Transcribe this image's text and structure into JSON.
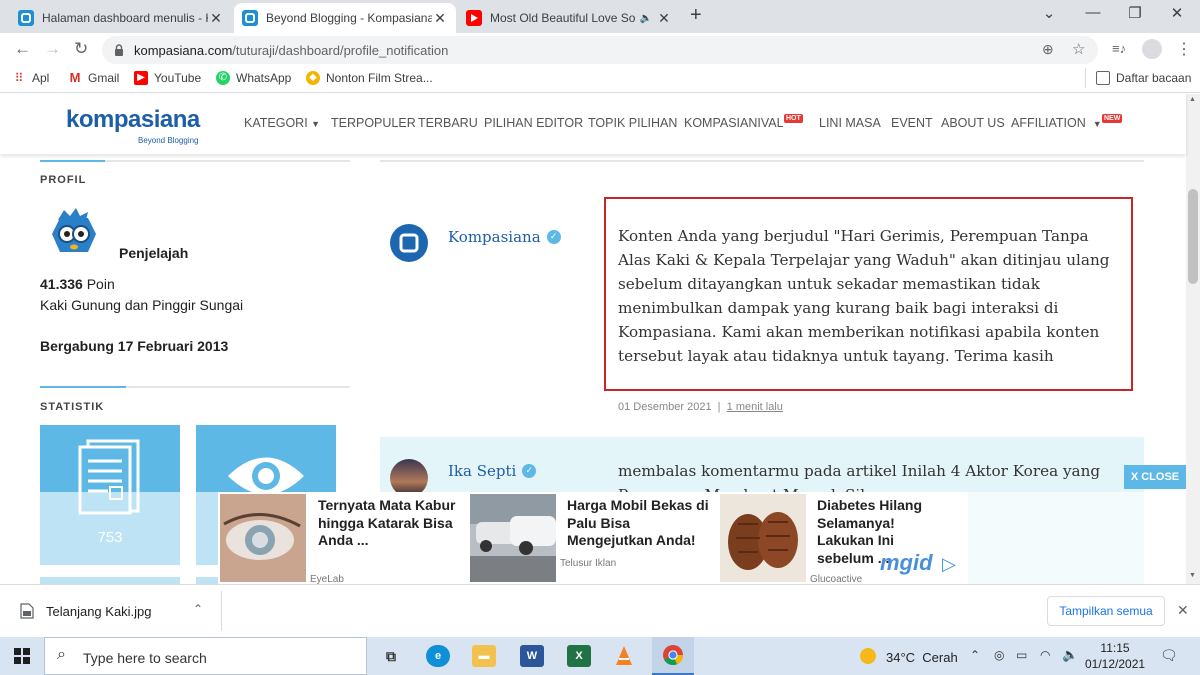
{
  "browser": {
    "tabs": [
      {
        "title": "Halaman dashboard menulis - Ko",
        "active": false
      },
      {
        "title": "Beyond Blogging - Kompasiana.c",
        "active": true
      },
      {
        "title": "Most Old Beautiful Love Son",
        "active": false
      }
    ],
    "url_domain": "kompasiana.com",
    "url_path": "/tuturaji/dashboard/profile_notification",
    "bookmarks": [
      "Apl",
      "Gmail",
      "YouTube",
      "WhatsApp",
      "Nonton Film Strea..."
    ],
    "reading_list": "Daftar bacaan"
  },
  "site": {
    "logo": "kompasiana",
    "tagline": "Beyond Blogging",
    "nav": [
      "KATEGORI",
      "TERPOPULER",
      "TERBARU",
      "PILIHAN EDITOR",
      "TOPIK PILIHAN",
      "KOMPASIANIVAL",
      "LINI MASA",
      "EVENT",
      "ABOUT US",
      "AFFILIATION"
    ],
    "badge_hot": "HOT",
    "badge_new": "NEW"
  },
  "profile": {
    "section_label": "PROFIL",
    "rank": "Penjelajah",
    "points_value": "41.336",
    "points_label": "Poin",
    "bio": "Kaki Gunung dan Pinggir Sungai",
    "joined": "Bergabung 17 Februari 2013"
  },
  "stats": {
    "section_label": "STATISTIK",
    "articles_count": "753"
  },
  "notifications": [
    {
      "sender": "Kompasiana",
      "verified": true,
      "message": "Konten Anda yang berjudul \"Hari Gerimis, Perempuan Tanpa Alas Kaki & Kepala Terpelajar yang Waduh\" akan ditinjau ulang sebelum ditayangkan untuk sekadar memastikan tidak menimbulkan dampak yang kurang baik bagi interaksi di Kompasiana. Kami akan memberikan notifikasi apabila konten tersebut layak atau tidaknya untuk tayang. Terima kasih",
      "date": "01 Desember 2021",
      "ago": "1 menit lalu"
    },
    {
      "sender": "Ika Septi",
      "verified": true,
      "message": "membalas komentarmu pada artikel Inilah 4 Aktor Korea yang Pesonanya Membuat Memak Silau"
    }
  ],
  "ads": {
    "close_label": "X CLOSE",
    "network": "mgid",
    "items": [
      {
        "title": "Ternyata Mata Kabur hingga Katarak Bisa Anda ...",
        "source": "EyeLab"
      },
      {
        "title": "Harga Mobil Bekas di Palu Bisa Mengejutkan Anda!",
        "source": "Telusur Iklan"
      },
      {
        "title": "Diabetes Hilang Selamanya! Lakukan Ini sebelum ...",
        "source": "Glucoactive"
      }
    ]
  },
  "downloads": {
    "file": "Telanjang Kaki.jpg",
    "show_all": "Tampilkan semua"
  },
  "taskbar": {
    "search_placeholder": "Type here to search",
    "weather_temp": "34°C",
    "weather_desc": "Cerah",
    "time": "11:15",
    "date": "01/12/2021"
  },
  "colors": {
    "brand": "#1d5ea8",
    "accent": "#5db8e6",
    "highlight_box": "#c62828",
    "hot_badge": "#e53935"
  }
}
